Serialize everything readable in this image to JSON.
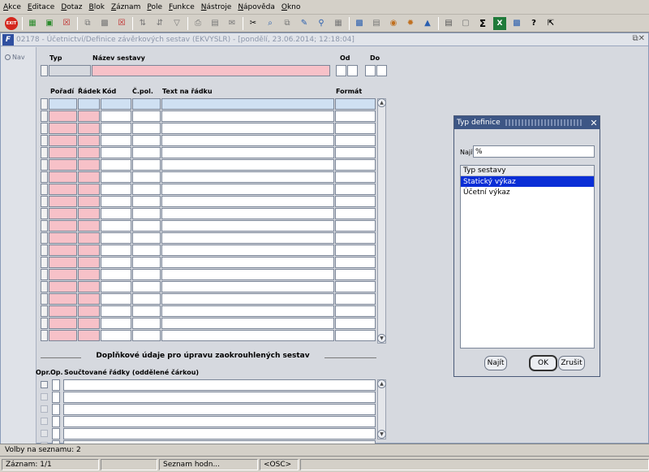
{
  "menu": [
    "Akce",
    "Editace",
    "Dotaz",
    "Blok",
    "Záznam",
    "Pole",
    "Funkce",
    "Nástroje",
    "Nápověda",
    "Okno"
  ],
  "toolbar_icons": [
    "exit-icon",
    "save-icon",
    "new-icon",
    "delete-icon",
    "copy-icon",
    "paste-icon",
    "clear-icon",
    "sort-asc-icon",
    "sort-desc-icon",
    "filter-icon",
    "print-icon",
    "print-preview-icon",
    "mail-icon",
    "cut-icon",
    "find-icon",
    "copy-record-icon",
    "edit-icon",
    "zoom-icon",
    "calc-icon",
    "clipboard-icon",
    "record-info-icon",
    "globe-icon",
    "settings-icon",
    "chart-icon",
    "report-icon",
    "form-icon",
    "sum-icon",
    "excel-icon",
    "notes-icon",
    "help-icon",
    "context-help-icon"
  ],
  "window": {
    "title": "02178 - Účetnictví/Definice závěrkových sestav (EKVYSLR) - [pondělí, 23.06.2014; 12:18:04]",
    "nav_label": "Nav"
  },
  "header_form": {
    "typ_label": "Typ",
    "nazev_label": "Název sestavy",
    "od_label": "Od",
    "do_label": "Do"
  },
  "grid": {
    "columns": [
      "Pořadí",
      "Řádek",
      "Kód",
      "Č.pol.",
      "Text na řádku",
      "Formát"
    ],
    "row_count": 20
  },
  "section": {
    "title": "Doplňkové údaje pro úpravu zaokrouhlených sestav",
    "columns": [
      "Opr.",
      "Op.",
      "Součtované řádky (oddělené čárkou)"
    ],
    "row_count": 6
  },
  "dialog": {
    "title": "Typ definice",
    "find_label": "Najít",
    "find_value": "%",
    "list_header": "Typ sestavy",
    "items": [
      "Statický výkaz",
      "Účetní výkaz"
    ],
    "selected_index": 0,
    "btn_find": "Najít",
    "btn_ok": "OK",
    "btn_cancel": "Zrušit"
  },
  "status": {
    "line1": "Volby na seznamu: 2",
    "record": "Záznam: 1/1",
    "list": "Seznam hodn...",
    "osc": "<OSC>"
  },
  "colors": {
    "required": "#f7c1c8",
    "current_row": "#cfe0f2",
    "selection": "#0a2ed6",
    "dialog_title": "#3d5685"
  }
}
